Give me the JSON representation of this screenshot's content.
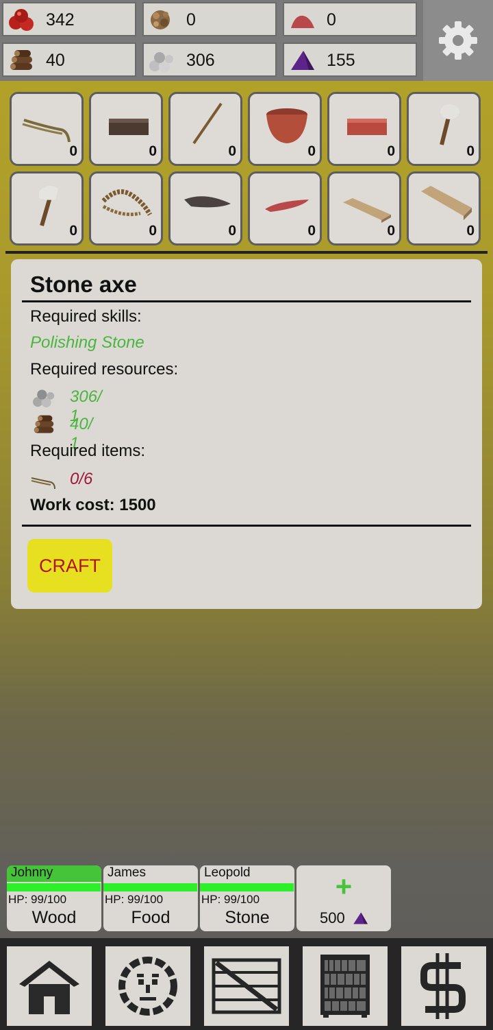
{
  "resources": {
    "apples": {
      "value": "342",
      "icon": "apples-icon"
    },
    "herbs": {
      "value": "0",
      "icon": "herbs-icon"
    },
    "clay": {
      "value": "0",
      "icon": "clay-icon"
    },
    "wood": {
      "value": "40",
      "icon": "wood-logs-icon"
    },
    "stone": {
      "value": "306",
      "icon": "stones-icon"
    },
    "crystal": {
      "value": "155",
      "icon": "purple-crystal-icon"
    }
  },
  "settings_icon": "gear-icon",
  "items": [
    {
      "name": "rope",
      "count": "0"
    },
    {
      "name": "brick",
      "count": "0"
    },
    {
      "name": "stick",
      "count": "0"
    },
    {
      "name": "bowl",
      "count": "0"
    },
    {
      "name": "clay-brick",
      "count": "0"
    },
    {
      "name": "stone-hammer",
      "count": "0"
    },
    {
      "name": "stone-axe",
      "count": "0"
    },
    {
      "name": "thick-rope",
      "count": "0"
    },
    {
      "name": "stone-blade",
      "count": "0"
    },
    {
      "name": "clay-slab",
      "count": "0"
    },
    {
      "name": "plank",
      "count": "0"
    },
    {
      "name": "board",
      "count": "0"
    }
  ],
  "recipe": {
    "title": "Stone axe",
    "skills_label": "Required skills:",
    "skill": "Polishing Stone",
    "resources_label": "Required resources:",
    "resource_stone": "306/ 1",
    "resource_wood": "40/ 1",
    "items_label": "Required items:",
    "item_rope": "0/6",
    "work_cost": "Work cost: 1500",
    "craft_label": "CRAFT"
  },
  "workers": [
    {
      "name": "Johnny",
      "hp": "HP: 99/100",
      "job": "Wood",
      "hp_fraction": 0.99
    },
    {
      "name": "James",
      "hp": "HP: 99/100",
      "job": "Food",
      "hp_fraction": 0.99
    },
    {
      "name": "Leopold",
      "hp": "HP: 99/100",
      "job": "Stone",
      "hp_fraction": 0.99
    }
  ],
  "hire": {
    "plus": "+",
    "cost": "500"
  },
  "nav": [
    "house-icon",
    "face-icon",
    "crate-icon",
    "bookshelf-icon",
    "dollar-icon"
  ],
  "colors": {
    "selected_worker": "#45c43a",
    "hp_bar": "#2ef02a",
    "craft_button": "#e7e021",
    "craft_text": "#b0141e",
    "ok": "#49b53e",
    "missing": "#9c1838"
  }
}
